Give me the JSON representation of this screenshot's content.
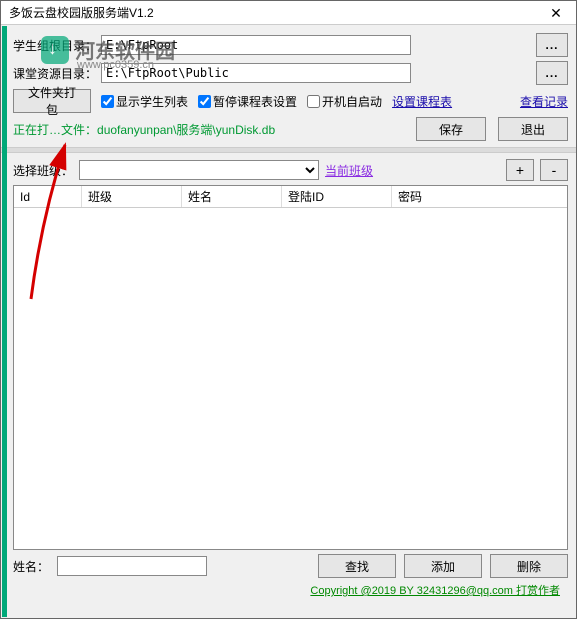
{
  "window": {
    "title": "多饭云盘校园版服务端V1.2"
  },
  "watermark": {
    "text": "河东软件园",
    "url": "www.pc0359.cn"
  },
  "paths": {
    "label1": "学生组根目录：",
    "value1": "E:\\FtpRoot",
    "label2": "课堂资源目录：",
    "value2": "E:\\FtpRoot\\Public",
    "browse": "..."
  },
  "buttons": {
    "pack": "文件夹打包",
    "save": "保存",
    "exit": "退出",
    "search": "查找",
    "add": "添加",
    "del": "删除",
    "plus": "+",
    "minus": "-"
  },
  "checks": {
    "showStudent": "显示学生列表",
    "pauseSched": "暂停课程表设置",
    "autostart": "开机自启动"
  },
  "links": {
    "setSched": "设置课程表",
    "viewLog": "查看记录",
    "curClass": "当前班级"
  },
  "status": {
    "prefix": "正在打…文件：",
    "file": "duofanyunpan\\服务端\\yunDisk.db"
  },
  "class_select": {
    "label": "选择班级："
  },
  "table": {
    "cols": [
      "Id",
      "班级",
      "姓名",
      "登陆ID",
      "密码"
    ]
  },
  "footer": {
    "label": "姓名："
  },
  "copyright": "Copyright @2019 BY 32431296@qq.com  打赏作者"
}
